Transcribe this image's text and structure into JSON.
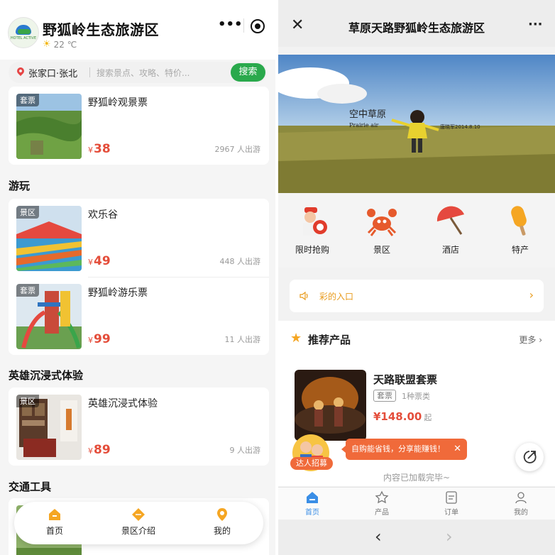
{
  "left": {
    "header": {
      "title": "野狐岭生态旅游区",
      "weather": "22 ℃",
      "logo_caption": "HOTEL ACTIVE"
    },
    "search": {
      "city": "张家口·张北",
      "placeholder": "搜索景点、攻略、特价...",
      "button": "搜索"
    },
    "top_item": {
      "tag": "套票",
      "name": "野狐岭观景票",
      "price": "38",
      "sold": "2967 人出游"
    },
    "sections": [
      {
        "title": "游玩",
        "items": [
          {
            "tag": "景区",
            "name": "欢乐谷",
            "price": "49",
            "sold": "448 人出游"
          },
          {
            "tag": "套票",
            "name": "野狐岭游乐票",
            "price": "99",
            "sold": "11 人出游"
          }
        ]
      },
      {
        "title": "英雄沉浸式体验",
        "items": [
          {
            "tag": "景区",
            "name": "英雄沉浸式体验",
            "price": "89",
            "sold": "9 人出游"
          }
        ]
      },
      {
        "title": "交通工具",
        "items": []
      }
    ],
    "currency": "¥",
    "tabbar": [
      {
        "label": "首页",
        "icon": "home-icon"
      },
      {
        "label": "景区介绍",
        "icon": "ticket-icon"
      },
      {
        "label": "我的",
        "icon": "location-icon"
      }
    ]
  },
  "right": {
    "header": {
      "title": "草原天路野狐岭生态旅游区",
      "close": "✕",
      "more": "···"
    },
    "banner": {
      "caption_1": "空中草原",
      "caption_2": "Prairie air",
      "caption_3": "唐晓军2014.8.10"
    },
    "categories": [
      {
        "label": "限时抢购",
        "icon": "flash-sale-icon"
      },
      {
        "label": "景区",
        "icon": "crab-icon"
      },
      {
        "label": "酒店",
        "icon": "umbrella-icon"
      },
      {
        "label": "特产",
        "icon": "popsicle-icon"
      }
    ],
    "notice": {
      "text": "彩的入口"
    },
    "recommend": {
      "title": "推荐产品",
      "more": "更多",
      "product": {
        "name": "天路联盟套票",
        "tag": "套票",
        "types": "1种票类",
        "price": "¥148.00",
        "suffix": "起"
      }
    },
    "promo": {
      "bubble": "自购能省钱，分享能赚钱！",
      "label": "达人招募"
    },
    "loaded": "内容已加载完毕~",
    "tabbar": [
      {
        "label": "首页",
        "icon": "home-icon",
        "active": true
      },
      {
        "label": "产品",
        "icon": "product-icon",
        "active": false
      },
      {
        "label": "订单",
        "icon": "order-icon",
        "active": false
      },
      {
        "label": "我的",
        "icon": "user-icon",
        "active": false
      }
    ]
  },
  "colors": {
    "price": "#e44d3a",
    "search_green": "#2aa94c",
    "notice_orange": "#e89a1a",
    "promo": "#f06a3a",
    "active_tab": "#3a8ee6"
  }
}
